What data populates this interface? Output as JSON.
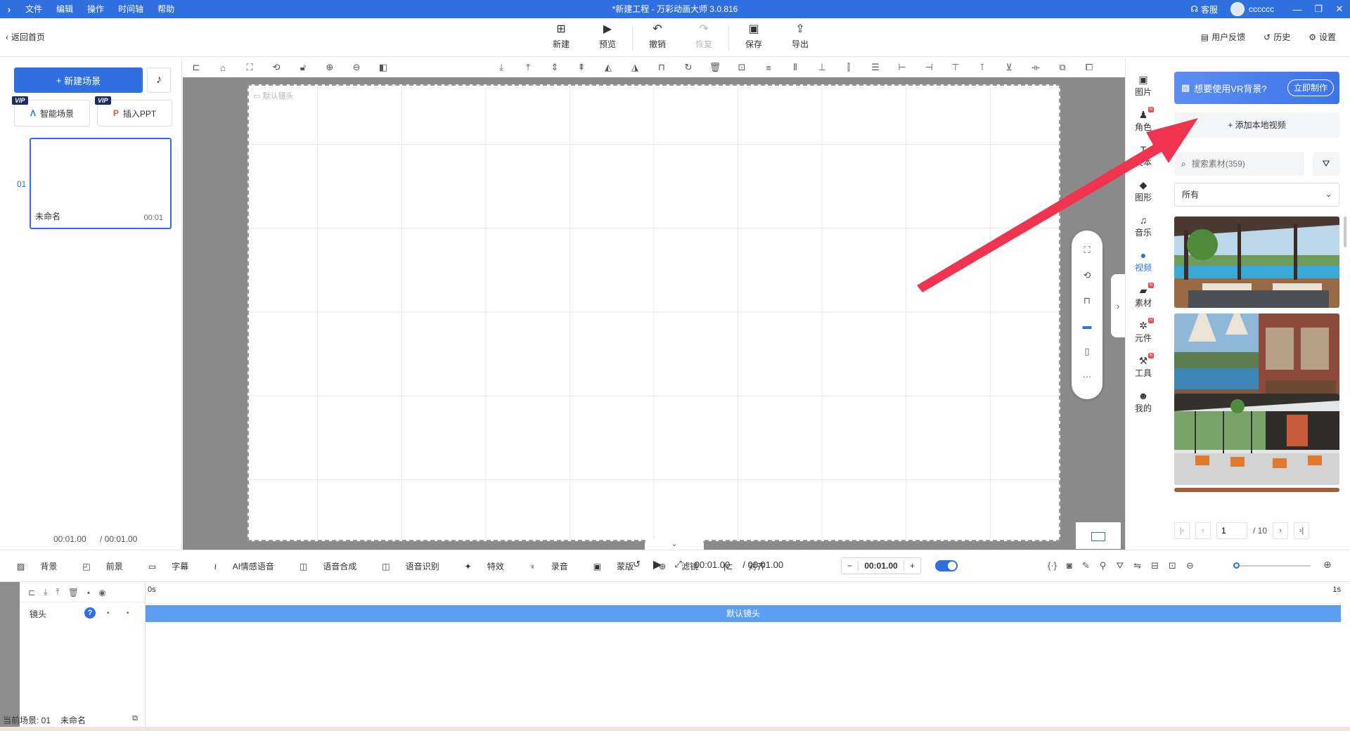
{
  "titlebar": {
    "menu": [
      "文件",
      "编辑",
      "操作",
      "时间轴",
      "帮助"
    ],
    "window_title": "*新建工程 - 万彩动画大师 3.0.816",
    "service": "客服",
    "username": "cccccc"
  },
  "toolbar": {
    "back": "返回首页",
    "buttons": [
      {
        "label": "新建",
        "icon": "new-icon",
        "disabled": false
      },
      {
        "label": "预览",
        "icon": "play-icon",
        "disabled": false
      },
      {
        "label": "撤销",
        "icon": "undo-icon",
        "disabled": false
      },
      {
        "label": "恢复",
        "icon": "redo-icon",
        "disabled": true
      },
      {
        "label": "保存",
        "icon": "save-icon",
        "disabled": false
      },
      {
        "label": "导出",
        "icon": "export-icon",
        "disabled": false
      }
    ],
    "feedback": "用户反馈",
    "history": "历史",
    "settings": "设置"
  },
  "left_panel": {
    "new_scene": "新建场景",
    "vip_badge": "VIP",
    "smart_scene": "智能场景",
    "insert_ppt": "插入PPT",
    "scenes": [
      {
        "num": "01",
        "name": "未命名",
        "duration": "00:01"
      }
    ],
    "current_time": "00:01.00",
    "total_time": "/ 00:01.00"
  },
  "canvas": {
    "camera_label": "默认镜头"
  },
  "right_rail": {
    "items": [
      {
        "label": "图片",
        "icon": "image-icon",
        "badge": false
      },
      {
        "label": "角色",
        "icon": "person-icon",
        "badge": true
      },
      {
        "label": "文本",
        "icon": "text-icon",
        "badge": false
      },
      {
        "label": "图形",
        "icon": "shape-icon",
        "badge": false
      },
      {
        "label": "音乐",
        "icon": "music-icon",
        "badge": false
      },
      {
        "label": "视频",
        "icon": "video-icon",
        "badge": false
      },
      {
        "label": "素材",
        "icon": "folder-icon",
        "badge": true
      },
      {
        "label": "元件",
        "icon": "component-icon",
        "badge": true
      },
      {
        "label": "工具",
        "icon": "wrench-icon",
        "badge": true
      },
      {
        "label": "我的",
        "icon": "user-icon",
        "badge": false
      }
    ],
    "active": "视频"
  },
  "right_panel": {
    "vr_text": "想要使用VR背景?",
    "vr_button": "立即制作",
    "add_local_video": "+ 添加本地视频",
    "search_placeholder": "搜索素材(359)",
    "category": "所有",
    "page": "1",
    "page_total": "/ 10"
  },
  "bottom_toolbar": {
    "tools": [
      {
        "label": "背景",
        "disabled": false
      },
      {
        "label": "前景",
        "disabled": false
      },
      {
        "label": "字幕",
        "disabled": false
      },
      {
        "label": "AI情感语音",
        "disabled": false
      },
      {
        "label": "语音合成",
        "disabled": false
      },
      {
        "label": "语音识别",
        "disabled": false
      },
      {
        "label": "特效",
        "disabled": false
      },
      {
        "label": "录音",
        "disabled": false
      },
      {
        "label": "蒙版",
        "disabled": false
      },
      {
        "label": "滤镜",
        "disabled": false
      },
      {
        "label": "对齐",
        "disabled": true
      }
    ],
    "current_time": "00:01.00",
    "total_time": "/ 00:01.00",
    "zoom_value": "00:01.00"
  },
  "timeline": {
    "ruler_start": "0s",
    "ruler_end": "1s",
    "track_name": "镜头",
    "track_clip": "默认镜头",
    "status_label": "当前场景: 01",
    "status_name": "未命名"
  },
  "colors": {
    "accent": "#2f6fe0",
    "track_clip": "#5b9ef4",
    "annotation_arrow": "#f0344f"
  }
}
